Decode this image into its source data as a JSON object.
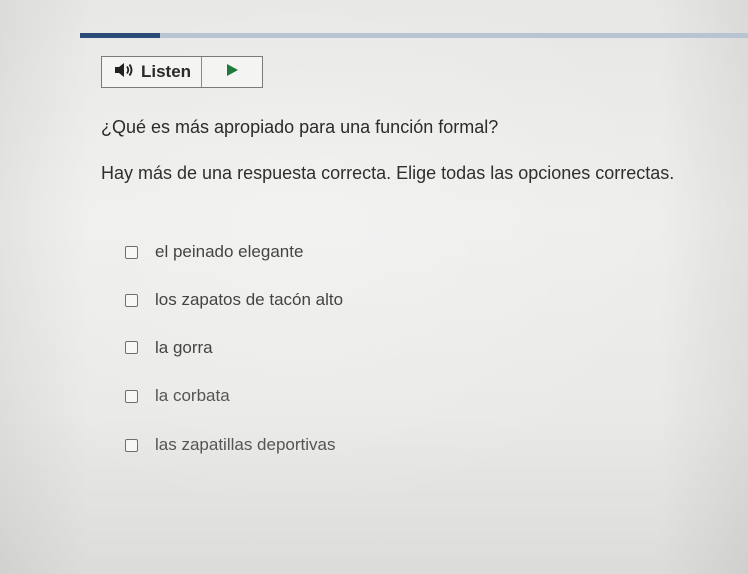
{
  "progress": {
    "fraction": 0.12,
    "fill_color": "#2c4a77",
    "track_color": "#b9c4d2"
  },
  "listen": {
    "label": "Listen",
    "speaker_icon": "speaker-icon",
    "play_icon": "play-icon",
    "play_color": "#1f7a3a"
  },
  "question": {
    "prompt": "¿Qué es más apropiado para una función formal?",
    "instruction": "Hay más de una respuesta correcta. Elige todas las opciones correctas."
  },
  "options": [
    {
      "label": "el peinado elegante",
      "checked": false
    },
    {
      "label": "los zapatos de tacón alto",
      "checked": false
    },
    {
      "label": "la gorra",
      "checked": false
    },
    {
      "label": "la corbata",
      "checked": false
    },
    {
      "label": "las zapatillas deportivas",
      "checked": false
    }
  ]
}
